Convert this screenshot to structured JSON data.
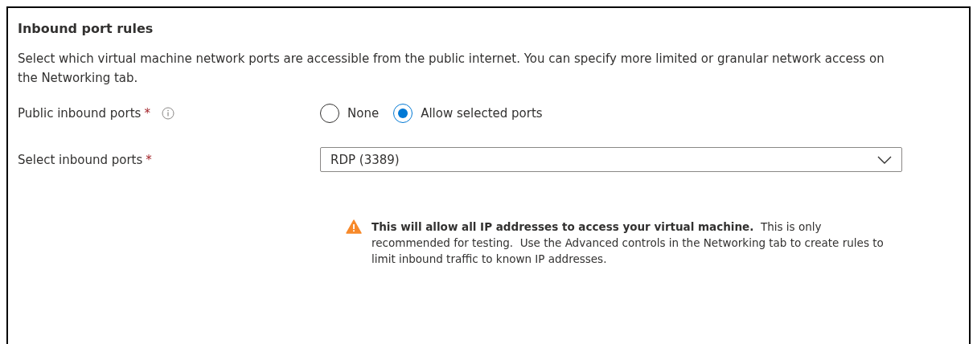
{
  "section": {
    "title": "Inbound port rules",
    "description": "Select which virtual machine network ports are accessible from the public internet. You can specify more limited or granular network access on the Networking tab.",
    "public_inbound_ports": {
      "label": "Public inbound ports",
      "required_mark": "*",
      "options": [
        {
          "label": "None",
          "selected": false
        },
        {
          "label": "Allow selected ports",
          "selected": true
        }
      ]
    },
    "select_inbound_ports": {
      "label": "Select inbound ports",
      "required_mark": "*",
      "value": "RDP (3389)"
    },
    "warning": "**This will allow all IP addresses to access your virtual machine.**  This is only recommended for testing.  Use the Advanced controls in the Networking tab to create rules to limit inbound traffic to known IP addresses."
  }
}
